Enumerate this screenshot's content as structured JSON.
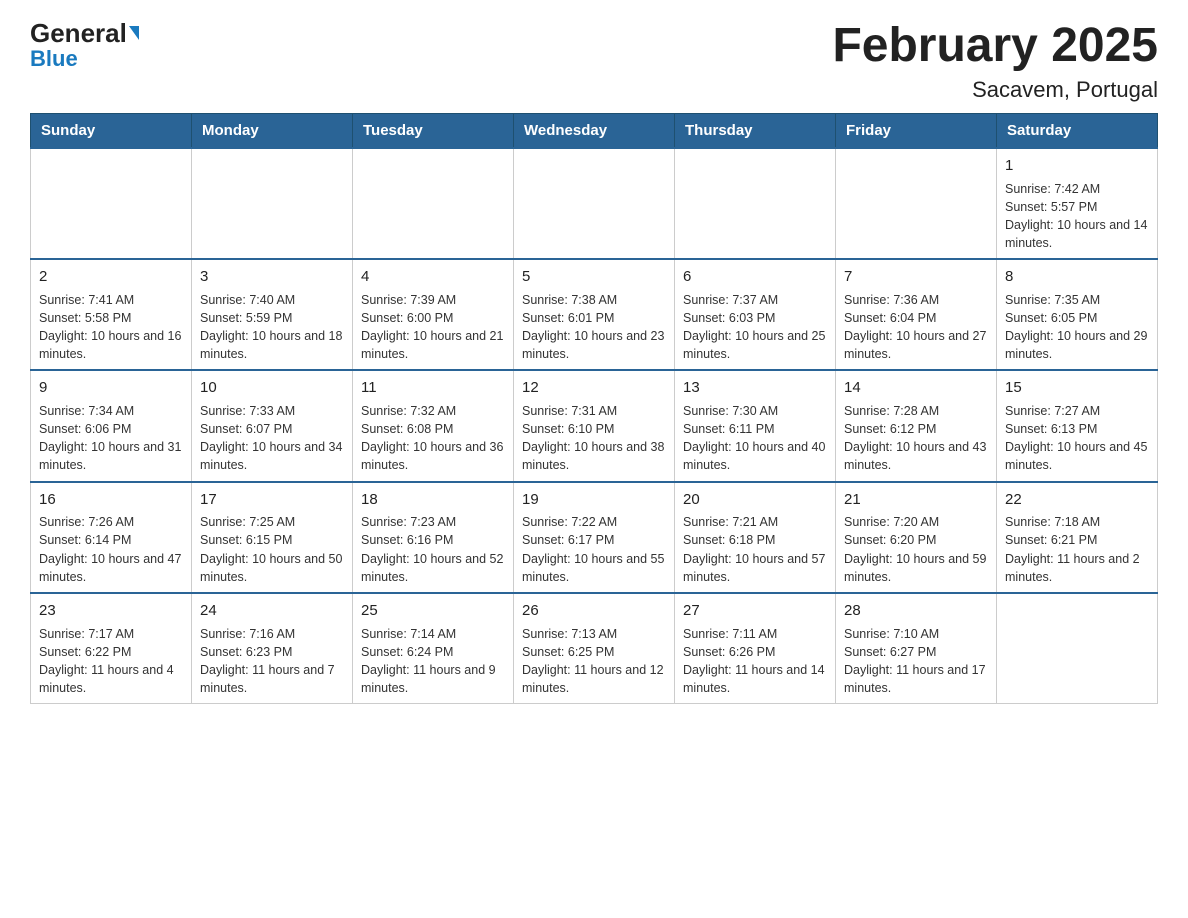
{
  "logo": {
    "general": "General",
    "triangle": "",
    "blue": "Blue"
  },
  "title": {
    "month": "February 2025",
    "location": "Sacavem, Portugal"
  },
  "weekdays": [
    "Sunday",
    "Monday",
    "Tuesday",
    "Wednesday",
    "Thursday",
    "Friday",
    "Saturday"
  ],
  "weeks": [
    [
      {
        "day": "",
        "info": ""
      },
      {
        "day": "",
        "info": ""
      },
      {
        "day": "",
        "info": ""
      },
      {
        "day": "",
        "info": ""
      },
      {
        "day": "",
        "info": ""
      },
      {
        "day": "",
        "info": ""
      },
      {
        "day": "1",
        "info": "Sunrise: 7:42 AM\nSunset: 5:57 PM\nDaylight: 10 hours and 14 minutes."
      }
    ],
    [
      {
        "day": "2",
        "info": "Sunrise: 7:41 AM\nSunset: 5:58 PM\nDaylight: 10 hours and 16 minutes."
      },
      {
        "day": "3",
        "info": "Sunrise: 7:40 AM\nSunset: 5:59 PM\nDaylight: 10 hours and 18 minutes."
      },
      {
        "day": "4",
        "info": "Sunrise: 7:39 AM\nSunset: 6:00 PM\nDaylight: 10 hours and 21 minutes."
      },
      {
        "day": "5",
        "info": "Sunrise: 7:38 AM\nSunset: 6:01 PM\nDaylight: 10 hours and 23 minutes."
      },
      {
        "day": "6",
        "info": "Sunrise: 7:37 AM\nSunset: 6:03 PM\nDaylight: 10 hours and 25 minutes."
      },
      {
        "day": "7",
        "info": "Sunrise: 7:36 AM\nSunset: 6:04 PM\nDaylight: 10 hours and 27 minutes."
      },
      {
        "day": "8",
        "info": "Sunrise: 7:35 AM\nSunset: 6:05 PM\nDaylight: 10 hours and 29 minutes."
      }
    ],
    [
      {
        "day": "9",
        "info": "Sunrise: 7:34 AM\nSunset: 6:06 PM\nDaylight: 10 hours and 31 minutes."
      },
      {
        "day": "10",
        "info": "Sunrise: 7:33 AM\nSunset: 6:07 PM\nDaylight: 10 hours and 34 minutes."
      },
      {
        "day": "11",
        "info": "Sunrise: 7:32 AM\nSunset: 6:08 PM\nDaylight: 10 hours and 36 minutes."
      },
      {
        "day": "12",
        "info": "Sunrise: 7:31 AM\nSunset: 6:10 PM\nDaylight: 10 hours and 38 minutes."
      },
      {
        "day": "13",
        "info": "Sunrise: 7:30 AM\nSunset: 6:11 PM\nDaylight: 10 hours and 40 minutes."
      },
      {
        "day": "14",
        "info": "Sunrise: 7:28 AM\nSunset: 6:12 PM\nDaylight: 10 hours and 43 minutes."
      },
      {
        "day": "15",
        "info": "Sunrise: 7:27 AM\nSunset: 6:13 PM\nDaylight: 10 hours and 45 minutes."
      }
    ],
    [
      {
        "day": "16",
        "info": "Sunrise: 7:26 AM\nSunset: 6:14 PM\nDaylight: 10 hours and 47 minutes."
      },
      {
        "day": "17",
        "info": "Sunrise: 7:25 AM\nSunset: 6:15 PM\nDaylight: 10 hours and 50 minutes."
      },
      {
        "day": "18",
        "info": "Sunrise: 7:23 AM\nSunset: 6:16 PM\nDaylight: 10 hours and 52 minutes."
      },
      {
        "day": "19",
        "info": "Sunrise: 7:22 AM\nSunset: 6:17 PM\nDaylight: 10 hours and 55 minutes."
      },
      {
        "day": "20",
        "info": "Sunrise: 7:21 AM\nSunset: 6:18 PM\nDaylight: 10 hours and 57 minutes."
      },
      {
        "day": "21",
        "info": "Sunrise: 7:20 AM\nSunset: 6:20 PM\nDaylight: 10 hours and 59 minutes."
      },
      {
        "day": "22",
        "info": "Sunrise: 7:18 AM\nSunset: 6:21 PM\nDaylight: 11 hours and 2 minutes."
      }
    ],
    [
      {
        "day": "23",
        "info": "Sunrise: 7:17 AM\nSunset: 6:22 PM\nDaylight: 11 hours and 4 minutes."
      },
      {
        "day": "24",
        "info": "Sunrise: 7:16 AM\nSunset: 6:23 PM\nDaylight: 11 hours and 7 minutes."
      },
      {
        "day": "25",
        "info": "Sunrise: 7:14 AM\nSunset: 6:24 PM\nDaylight: 11 hours and 9 minutes."
      },
      {
        "day": "26",
        "info": "Sunrise: 7:13 AM\nSunset: 6:25 PM\nDaylight: 11 hours and 12 minutes."
      },
      {
        "day": "27",
        "info": "Sunrise: 7:11 AM\nSunset: 6:26 PM\nDaylight: 11 hours and 14 minutes."
      },
      {
        "day": "28",
        "info": "Sunrise: 7:10 AM\nSunset: 6:27 PM\nDaylight: 11 hours and 17 minutes."
      },
      {
        "day": "",
        "info": ""
      }
    ]
  ]
}
